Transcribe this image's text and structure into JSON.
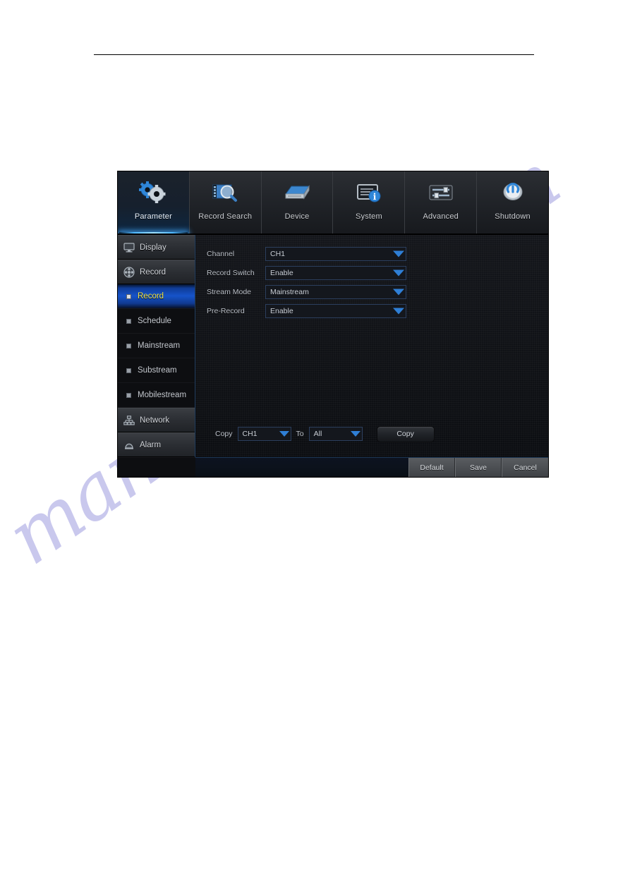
{
  "document": {
    "header_rule": true
  },
  "watermark": {
    "script_text": "manualshive.com",
    "flat_text": "manualshive.com"
  },
  "dvr": {
    "topnav": [
      {
        "label": "Parameter",
        "icon": "gears-icon",
        "active": true
      },
      {
        "label": "Record Search",
        "icon": "film-search-icon",
        "active": false
      },
      {
        "label": "Device",
        "icon": "hard-drive-icon",
        "active": false
      },
      {
        "label": "System",
        "icon": "monitor-info-icon",
        "active": false
      },
      {
        "label": "Advanced",
        "icon": "sliders-icon",
        "active": false
      },
      {
        "label": "Shutdown",
        "icon": "power-icon",
        "active": false
      }
    ],
    "sidebar": [
      {
        "label": "Display",
        "type": "main",
        "icon": "monitor-icon",
        "active": false
      },
      {
        "label": "Record",
        "type": "main",
        "icon": "film-reel-icon",
        "active": false
      },
      {
        "label": "Record",
        "type": "sub",
        "icon": "bullet-icon",
        "active": true
      },
      {
        "label": "Schedule",
        "type": "sub",
        "icon": "bullet-icon",
        "active": false
      },
      {
        "label": "Mainstream",
        "type": "sub",
        "icon": "bullet-icon",
        "active": false
      },
      {
        "label": "Substream",
        "type": "sub",
        "icon": "bullet-icon",
        "active": false
      },
      {
        "label": "Mobilestream",
        "type": "sub",
        "icon": "bullet-icon",
        "active": false
      },
      {
        "label": "Network",
        "type": "main",
        "icon": "network-icon",
        "active": false
      },
      {
        "label": "Alarm",
        "type": "main",
        "icon": "bell-icon",
        "active": false
      }
    ],
    "form": {
      "fields": [
        {
          "label": "Channel",
          "value": "CH1"
        },
        {
          "label": "Record Switch",
          "value": "Enable"
        },
        {
          "label": "Stream Mode",
          "value": "Mainstream"
        },
        {
          "label": "Pre-Record",
          "value": "Enable"
        }
      ]
    },
    "copy_row": {
      "copy_label": "Copy",
      "source_value": "CH1",
      "to_label": "To",
      "target_value": "All",
      "copy_button": "Copy"
    },
    "actions": [
      {
        "label": "Default"
      },
      {
        "label": "Save"
      },
      {
        "label": "Cancel"
      }
    ],
    "colors": {
      "accent_blue": "#1653c9",
      "active_text_yellow": "#f2e54a",
      "arrow_blue": "#2f7fd6",
      "panel_bg": "#0b0c10"
    }
  }
}
